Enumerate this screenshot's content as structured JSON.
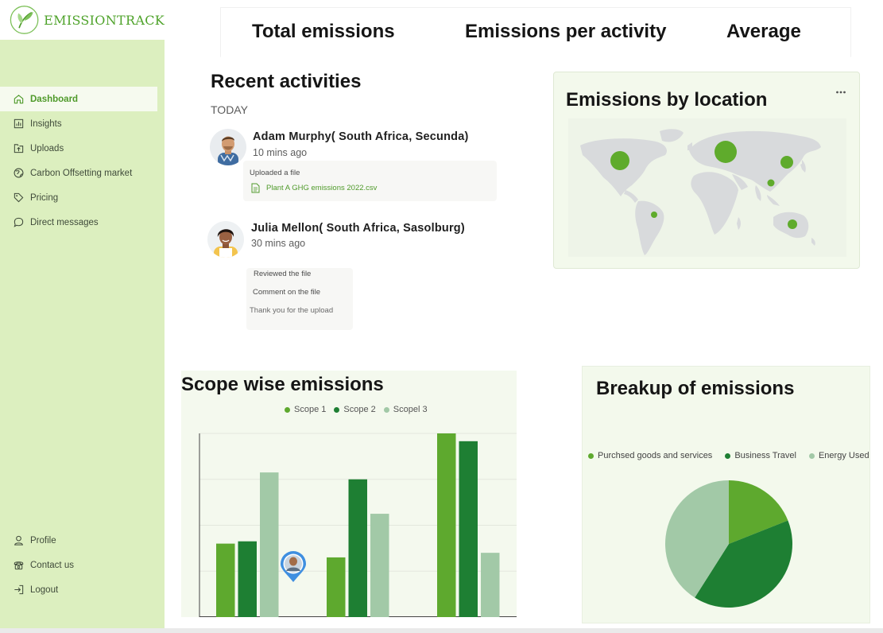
{
  "brand": {
    "name": "EMISSIONTRACK"
  },
  "sidebar": {
    "items": [
      {
        "label": "Dashboard",
        "icon": "home-icon",
        "active": true
      },
      {
        "label": "Insights",
        "icon": "bar-chart-icon"
      },
      {
        "label": "Uploads",
        "icon": "upload-icon"
      },
      {
        "label": "Carbon Offsetting market",
        "icon": "globe-icon"
      },
      {
        "label": "Pricing",
        "icon": "tag-icon"
      },
      {
        "label": "Direct messages",
        "icon": "chat-icon"
      }
    ],
    "bottom": [
      {
        "label": "Profile",
        "icon": "user-icon"
      },
      {
        "label": "Contact us",
        "icon": "phone-icon"
      },
      {
        "label": "Logout",
        "icon": "logout-icon"
      }
    ]
  },
  "stats": {
    "total": "Total emissions",
    "per_activity": "Emissions per activity",
    "average": "Average"
  },
  "recent": {
    "title": "Recent activities",
    "day": "TODAY",
    "activities": [
      {
        "name": "Adam Murphy( South Africa, Secunda)",
        "time": "10 mins ago",
        "action": "Uploaded a file",
        "file": "Plant A GHG emissions 2022.csv"
      },
      {
        "name": "Julia Mellon( South Africa, Sasolburg)",
        "time": "30 mins ago",
        "line1": "Reviewed the file",
        "line2": "Comment on the file",
        "line3": "Thank you for the upload"
      }
    ]
  },
  "map": {
    "title": "Emissions by location",
    "menu_icon": "more-icon"
  },
  "colors": {
    "scope1": "#5ea92e",
    "scope2": "#1e7f33",
    "scope3": "#a2c9a7",
    "sidebar": "#dcefbf"
  },
  "chart_data": [
    {
      "type": "bar",
      "title": "Scope wise emissions",
      "categories": [
        "",
        "",
        ""
      ],
      "series": [
        {
          "name": "Scope 1",
          "values": [
            16,
            13,
            40
          ]
        },
        {
          "name": "Scope 2",
          "values": [
            16.5,
            30,
            38.3
          ]
        },
        {
          "name": "Scopel 3",
          "values": [
            31.5,
            22.5,
            14
          ]
        }
      ],
      "ylim": [
        0,
        40
      ],
      "grid": true,
      "legend": "top"
    },
    {
      "type": "pie",
      "title": "Breakup of emissions",
      "labels": [
        "Purchsed goods and services",
        "Business Travel",
        "Energy Used"
      ],
      "values": [
        19,
        40,
        41
      ],
      "legend": "top"
    }
  ]
}
